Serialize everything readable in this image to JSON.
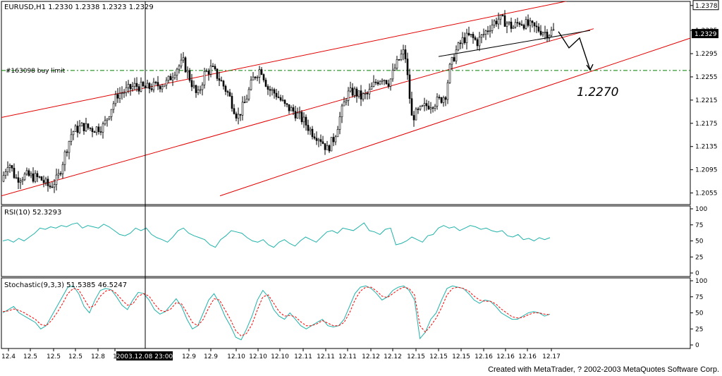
{
  "header": {
    "main_label": "EURUSD,H1  1.2330 1.2338 1.2323 1.2329",
    "rsi_label": "RSI(10)  52.3293",
    "stoch_label": "Stochastic(9,3,3)  51.5385  46.5247",
    "order_label": "#163098 buy limit",
    "annotation": "1.2270",
    "cursor_time": "2003.12.08 23:00",
    "footer": "Created with MetaTrader, ? 2002-2003 MetaQuotes Software Corp."
  },
  "colors": {
    "background": "#ffffff",
    "candle": "#000000",
    "channel": "#e00000",
    "order_line": "#008000",
    "rsi": "#20b2aa",
    "stoch_main": "#20b2aa",
    "stoch_signal": "#ff0000",
    "last_price_bg": "#000000"
  },
  "chart_data": [
    {
      "type": "candlestick",
      "symbol": "EURUSD",
      "timeframe": "H1",
      "ylim": [
        1.2035,
        1.2385
      ],
      "y_ticks": [
        "1.2378",
        "1.2335",
        "1.2295",
        "1.2255",
        "1.2215",
        "1.2175",
        "1.2135",
        "1.2095",
        "1.2055"
      ],
      "last_price": "1.2329",
      "order_level": 1.2266,
      "x_ticks": [
        "12.4",
        "12.5",
        "12.5",
        "12.5",
        "12.8",
        "1",
        "12.9",
        "12.9",
        "12.10",
        "12.10",
        "12.10",
        "12.11",
        "12.11",
        "12.11",
        "12.12",
        "12.12",
        "12.15",
        "12.15",
        "12.15",
        "12.16",
        "12.16",
        "12.16",
        "12.17"
      ],
      "close_path": [
        [
          0,
          1.2075
        ],
        [
          10,
          1.211
        ],
        [
          20,
          1.208
        ],
        [
          35,
          1.2085
        ],
        [
          55,
          1.208
        ],
        [
          68,
          1.2065
        ],
        [
          80,
          1.208
        ],
        [
          92,
          1.213
        ],
        [
          100,
          1.216
        ],
        [
          115,
          1.217
        ],
        [
          130,
          1.2165
        ],
        [
          145,
          1.217
        ],
        [
          155,
          1.22
        ],
        [
          165,
          1.2225
        ],
        [
          175,
          1.223
        ],
        [
          190,
          1.224
        ],
        [
          205,
          1.2235
        ],
        [
          220,
          1.224
        ],
        [
          235,
          1.2245
        ],
        [
          248,
          1.227
        ],
        [
          258,
          1.228
        ],
        [
          268,
          1.225
        ],
        [
          278,
          1.222
        ],
        [
          288,
          1.226
        ],
        [
          298,
          1.227
        ],
        [
          310,
          1.225
        ],
        [
          322,
          1.2225
        ],
        [
          335,
          1.2185
        ],
        [
          345,
          1.221
        ],
        [
          358,
          1.2255
        ],
        [
          368,
          1.227
        ],
        [
          378,
          1.2235
        ],
        [
          390,
          1.2225
        ],
        [
          402,
          1.2205
        ],
        [
          415,
          1.2195
        ],
        [
          428,
          1.218
        ],
        [
          440,
          1.216
        ],
        [
          452,
          1.215
        ],
        [
          462,
          1.213
        ],
        [
          472,
          1.215
        ],
        [
          480,
          1.2185
        ],
        [
          490,
          1.2225
        ],
        [
          500,
          1.223
        ],
        [
          510,
          1.222
        ],
        [
          520,
          1.2225
        ],
        [
          530,
          1.2245
        ],
        [
          540,
          1.2255
        ],
        [
          550,
          1.2245
        ],
        [
          558,
          1.227
        ],
        [
          566,
          1.229
        ],
        [
          572,
          1.23
        ],
        [
          582,
          1.2185
        ],
        [
          592,
          1.2195
        ],
        [
          602,
          1.2205
        ],
        [
          612,
          1.221
        ],
        [
          622,
          1.2215
        ],
        [
          630,
          1.2225
        ],
        [
          636,
          1.227
        ],
        [
          645,
          1.23
        ],
        [
          655,
          1.232
        ],
        [
          665,
          1.2325
        ],
        [
          675,
          1.2315
        ],
        [
          685,
          1.233
        ],
        [
          695,
          1.2345
        ],
        [
          705,
          1.2355
        ],
        [
          715,
          1.235
        ],
        [
          725,
          1.234
        ],
        [
          735,
          1.235
        ],
        [
          745,
          1.2345
        ],
        [
          755,
          1.234
        ],
        [
          765,
          1.2335
        ],
        [
          775,
          1.233
        ],
        [
          785,
          1.2335
        ]
      ],
      "channel_lines": [
        {
          "p1": [
            0,
            1.2185
          ],
          "p2": [
            840,
            1.2395
          ]
        },
        {
          "p1": [
            0,
            1.205
          ],
          "p2": [
            840,
            1.2338
          ]
        },
        {
          "p1": [
            310,
            1.205
          ],
          "p2": [
            985,
            1.2325
          ]
        }
      ],
      "trend_line": {
        "p1": [
          620,
          1.229
        ],
        "p2": [
          835,
          1.2335
        ]
      },
      "forecast_path": [
        [
          790,
          1.2333
        ],
        [
          805,
          1.2305
        ],
        [
          820,
          1.2322
        ],
        [
          835,
          1.2267
        ]
      ]
    },
    {
      "type": "line",
      "name": "RSI(10)",
      "ylim": [
        0,
        100
      ],
      "y_ticks": [
        "100",
        "75",
        "50",
        "25",
        "0"
      ],
      "values": [
        50,
        52,
        48,
        54,
        50,
        56,
        62,
        70,
        68,
        72,
        70,
        74,
        72,
        76,
        78,
        70,
        74,
        72,
        70,
        76,
        72,
        66,
        60,
        58,
        62,
        70,
        66,
        70,
        60,
        55,
        52,
        48,
        56,
        66,
        70,
        62,
        58,
        55,
        52,
        44,
        40,
        52,
        58,
        66,
        64,
        62,
        55,
        50,
        48,
        52,
        44,
        40,
        48,
        52,
        46,
        42,
        50,
        56,
        52,
        48,
        56,
        64,
        66,
        62,
        70,
        68,
        66,
        72,
        78,
        66,
        64,
        60,
        68,
        70,
        44,
        46,
        50,
        56,
        52,
        48,
        58,
        60,
        70,
        74,
        70,
        72,
        66,
        70,
        74,
        72,
        68,
        70,
        66,
        64,
        66,
        58,
        56,
        60,
        52,
        54,
        50,
        55,
        52,
        55
      ]
    },
    {
      "type": "line",
      "name": "Stochastic(9,3,3)",
      "ylim": [
        0,
        100
      ],
      "y_ticks": [
        "100",
        "75",
        "50",
        "25",
        "0"
      ],
      "series": [
        {
          "name": "main",
          "values": [
            50,
            55,
            60,
            50,
            45,
            40,
            35,
            25,
            30,
            45,
            60,
            75,
            90,
            92,
            80,
            60,
            50,
            70,
            85,
            88,
            86,
            75,
            62,
            55,
            70,
            82,
            80,
            70,
            55,
            48,
            52,
            62,
            72,
            60,
            40,
            25,
            30,
            50,
            70,
            80,
            65,
            45,
            30,
            12,
            8,
            25,
            45,
            70,
            85,
            75,
            55,
            45,
            40,
            50,
            40,
            30,
            25,
            30,
            35,
            40,
            30,
            28,
            30,
            40,
            60,
            80,
            90,
            92,
            88,
            80,
            70,
            75,
            85,
            90,
            92,
            85,
            70,
            10,
            20,
            40,
            50,
            70,
            88,
            92,
            90,
            88,
            80,
            70,
            65,
            70,
            68,
            60,
            50,
            45,
            40,
            40,
            45,
            50,
            52,
            50,
            45,
            48
          ]
        },
        {
          "name": "signal",
          "values": [
            52,
            53,
            56,
            54,
            50,
            45,
            40,
            32,
            30,
            38,
            50,
            64,
            80,
            88,
            86,
            72,
            58,
            62,
            76,
            84,
            86,
            80,
            70,
            62,
            64,
            76,
            80,
            76,
            64,
            54,
            52,
            56,
            66,
            64,
            50,
            35,
            30,
            40,
            58,
            72,
            70,
            55,
            40,
            22,
            14,
            18,
            32,
            55,
            75,
            78,
            65,
            52,
            45,
            46,
            44,
            36,
            30,
            30,
            33,
            38,
            34,
            30,
            30,
            35,
            50,
            70,
            84,
            90,
            90,
            84,
            76,
            74,
            80,
            86,
            90,
            88,
            78,
            30,
            20,
            30,
            42,
            58,
            78,
            88,
            90,
            88,
            84,
            76,
            70,
            68,
            68,
            64,
            56,
            50,
            44,
            42,
            43,
            47,
            50,
            50,
            48,
            47
          ]
        }
      ]
    }
  ]
}
